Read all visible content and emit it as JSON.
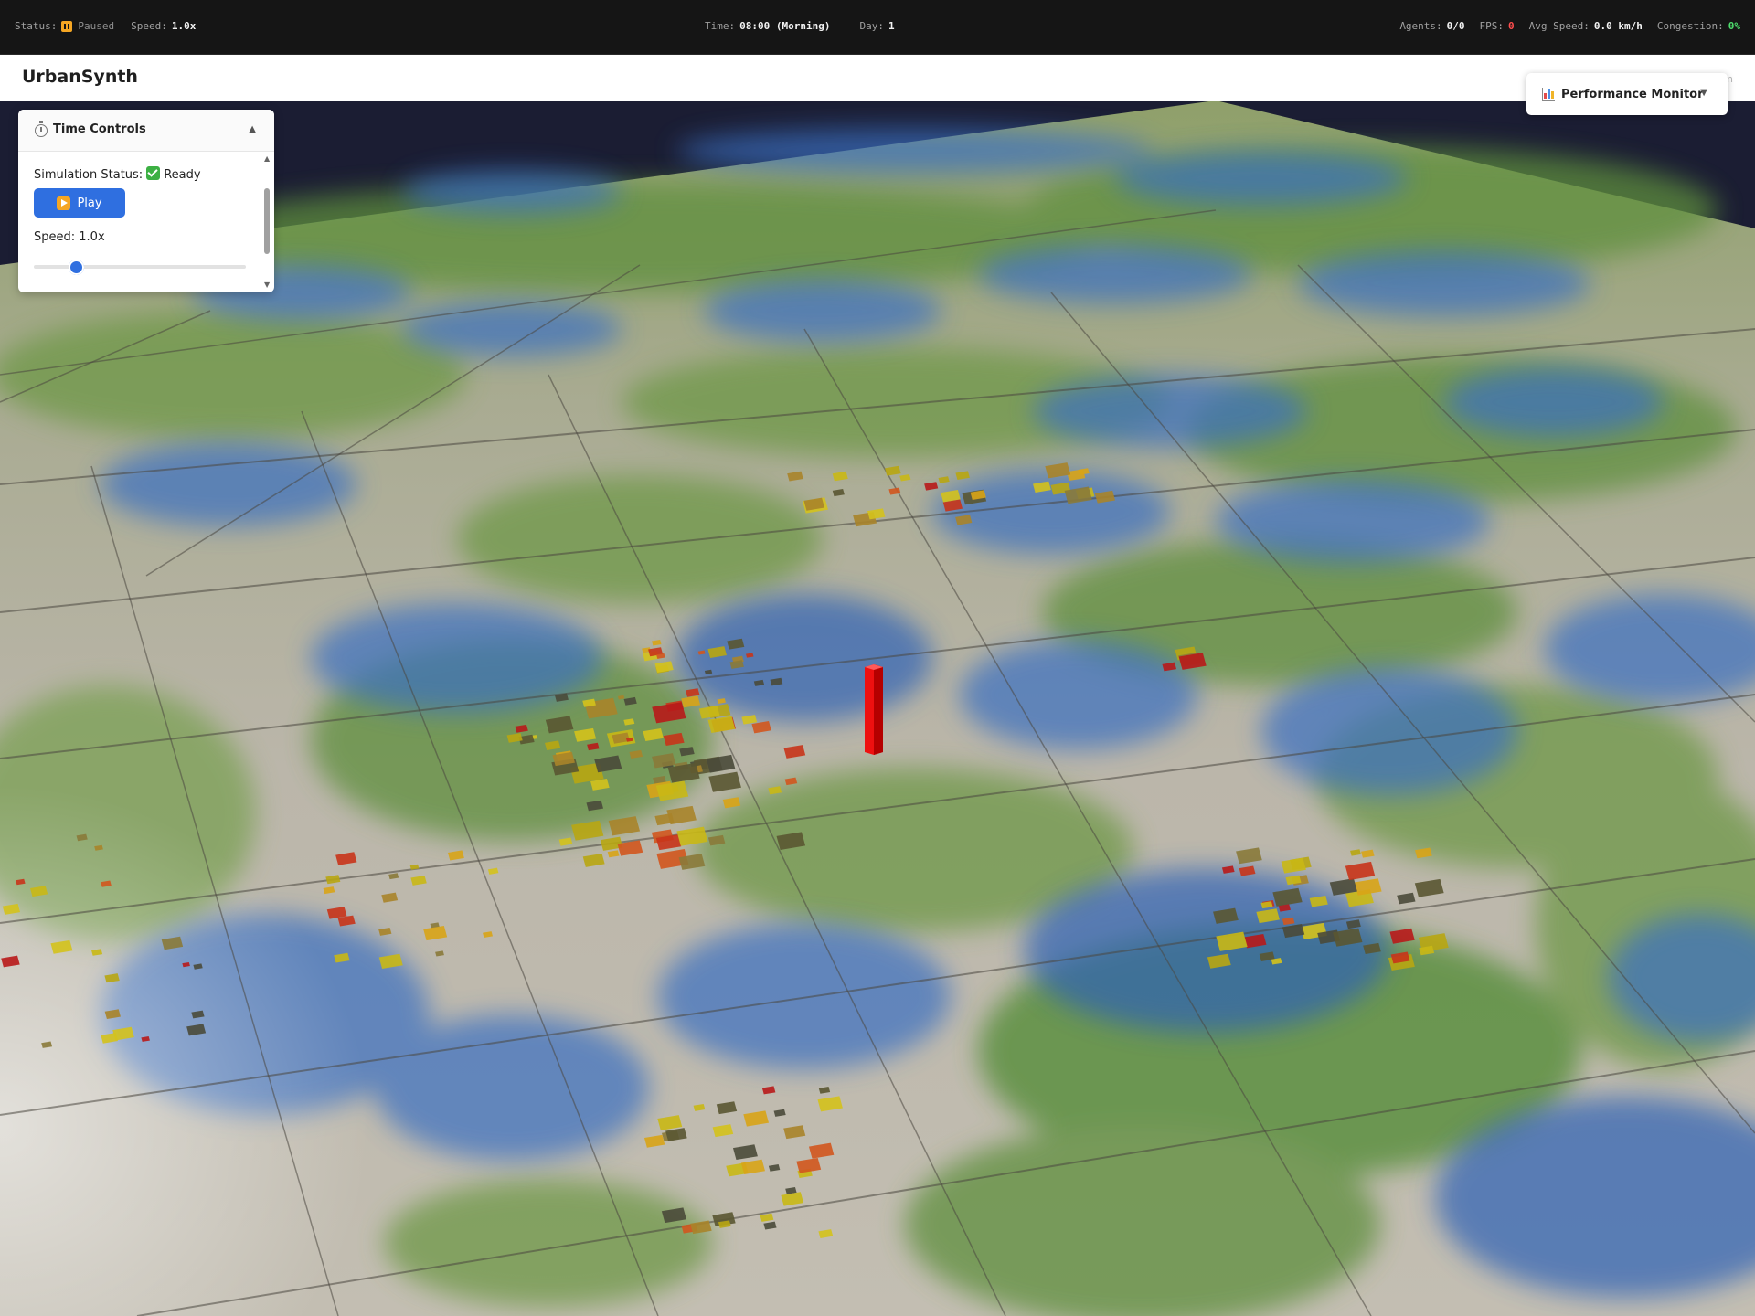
{
  "status_bar": {
    "status_label": "Status:",
    "status_value": "Paused",
    "speed_label": "Speed:",
    "speed_value": "1.0x",
    "time_label": "Time:",
    "time_value": "08:00 (Morning)",
    "day_label": "Day:",
    "day_value": "1",
    "agents_label": "Agents:",
    "agents_value": "0/0",
    "fps_label": "FPS:",
    "fps_value": "0",
    "avg_speed_label": "Avg Speed:",
    "avg_speed_value": "0.0 km/h",
    "congestion_label": "Congestion:",
    "congestion_value": "0%"
  },
  "header": {
    "title": "UrbanSynth",
    "ghost_text": "m"
  },
  "time_controls": {
    "title": "Time Controls",
    "collapse_glyph": "▲",
    "status_label": "Simulation Status:",
    "status_value": "Ready",
    "play_label": "Play",
    "speed_text": "Speed: 1.0x",
    "speed_fraction": 0.2,
    "scroll_up_glyph": "▲",
    "scroll_down_glyph": "▼"
  },
  "performance_monitor": {
    "title": "Performance Monitor",
    "chevron": "▼"
  },
  "colors": {
    "accent_blue": "#2f6fe0",
    "paused_orange": "#f5a623",
    "ready_green": "#3cb043",
    "fps_red": "#ff4d4d",
    "congestion_green": "#4ddb6c",
    "sky": "#1b1d33",
    "ground": "#b5b0a4",
    "vegetation": "#5f8f3c",
    "water": "#3b6fc1",
    "marker_red": "#e01010"
  },
  "icons": {
    "status": "pause-icon",
    "ready": "check-icon",
    "play": "play-icon",
    "time_controls": "stopwatch-icon",
    "performance": "bar-chart-icon"
  }
}
